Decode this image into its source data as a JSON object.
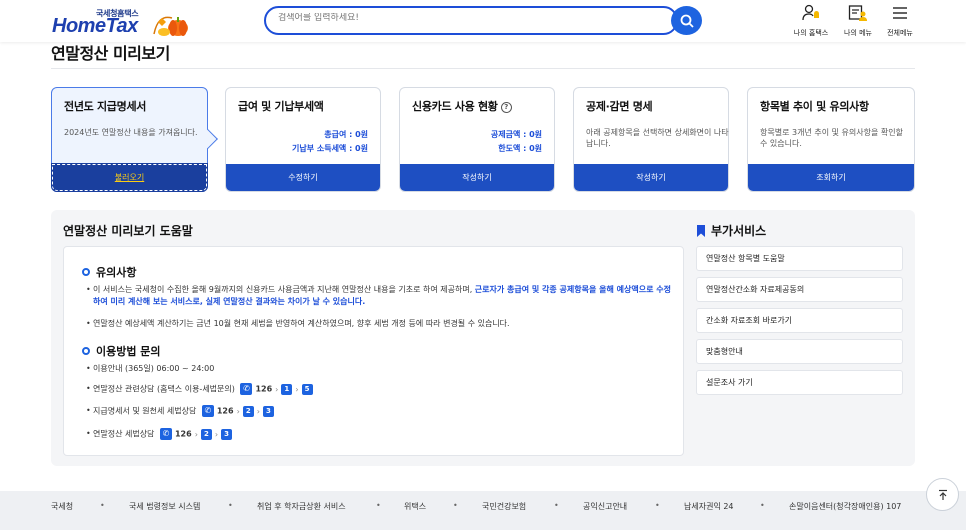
{
  "header": {
    "logo_small": "국세청홈택스",
    "logo_main": "HomeTax",
    "search_placeholder": "검색어를 입력하세요!",
    "menus": [
      {
        "label": "나의 홈택스",
        "icon": "user-bell-icon"
      },
      {
        "label": "나의 메뉴",
        "icon": "my-menu-icon"
      },
      {
        "label": "전체메뉴",
        "icon": "hamburger-icon"
      }
    ]
  },
  "page": {
    "title": "연말정산 미리보기"
  },
  "steps": [
    {
      "title": "전년도 지급명세서",
      "desc": "2024년도 연말정산 내용을 가져옵니다.",
      "button": "불러오기"
    },
    {
      "title": "급여 및 기납부세액",
      "values": [
        "총급여 : 0원",
        "기납부 소득세액 : 0원"
      ],
      "button": "수정하기"
    },
    {
      "title": "신용카드 사용 현황",
      "help": "?",
      "values": [
        "공제금액 : 0원",
        "한도액 : 0원"
      ],
      "button": "작성하기"
    },
    {
      "title": "공제·감면 명세",
      "desc": "아래 공제항목을 선택하면 상세화면이 나타납니다.",
      "button": "작성하기"
    },
    {
      "title": "항목별 추이 및 유의사항",
      "desc": "항목별로 3개년 추이 및 유의사항을 확인할 수 있습니다.",
      "button": "조회하기"
    }
  ],
  "help": {
    "title": "연말정산 미리보기 도움말",
    "notice_title": "유의사항",
    "notice1_plain": "이 서비스는 국세청이 수집한 올해 9월까지의 신용카드 사용금액과 지난해 연말정산 내용을 기초로 하여 제공하며,",
    "notice1_highlight": "근로자가 총급여 및 각종 공제항목을 올해 예상액으로 수정하여 미리 계산해 보는 서비스로, 실제 연말정산 결과와는 차이가 날 수 있습니다.",
    "notice2": "연말정산 예상세액 계산하기는 금년 10월 현재 세법을 반영하여 계산하였으며, 향후 세법 개정 등에 따라 변경될 수 있습니다.",
    "inquiry_title": "이용방법 문의",
    "hours": "이용안내 (365일) 06:00 ~ 24:00",
    "contacts": [
      {
        "label": "연말정산 관련상담 (홈택스 이용-세법문의)",
        "number": "126",
        "steps": [
          "1",
          "5"
        ]
      },
      {
        "label": "지급명세서 및 원천세 세법상담",
        "number": "126",
        "steps": [
          "2",
          "3"
        ]
      },
      {
        "label": "연말정산 세법상담",
        "number": "126",
        "steps": [
          "2",
          "3"
        ]
      }
    ]
  },
  "services": {
    "title": "부가서비스",
    "items": [
      "연말정산 항목별 도움말",
      "연말정산간소화 자료제공동의",
      "간소화 자료조회 바로가기",
      "맞춤형안내",
      "설문조사 가기"
    ]
  },
  "footer": {
    "items": [
      "국세청",
      "국세 법령정보 시스템",
      "취업 후 학자금상환 서비스",
      "위택스",
      "국민건강보험",
      "공익신고안내",
      "납세자권익 24",
      "손말이음센터(청각장애인용) 107"
    ]
  },
  "colors": {
    "primary": "#1d63e0",
    "button": "#1e4fc2",
    "highlight": "#1d4ed8"
  }
}
